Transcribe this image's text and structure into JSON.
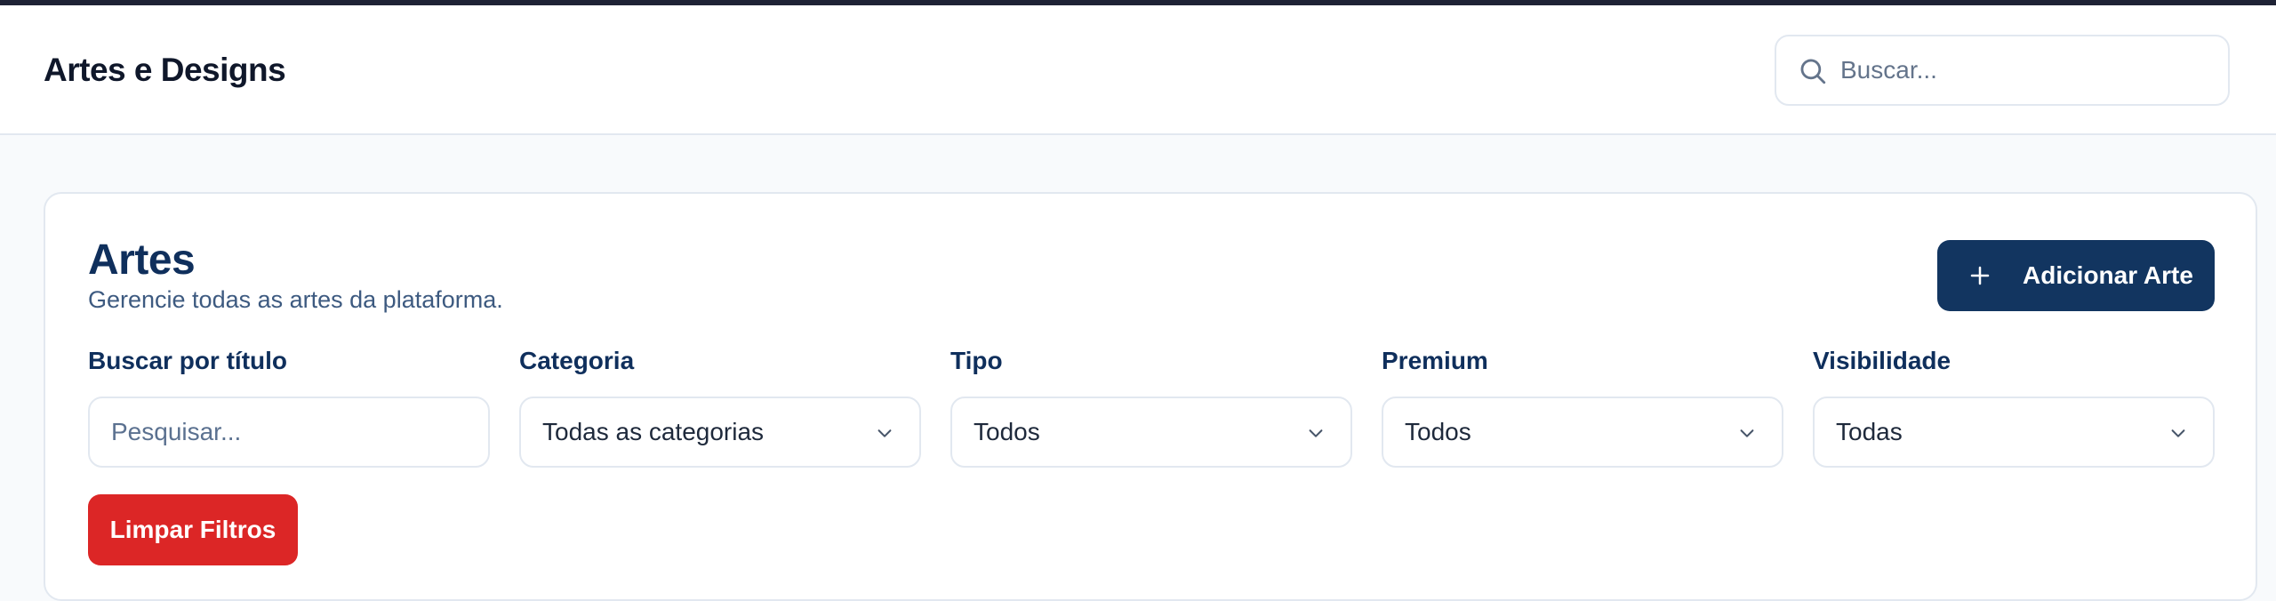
{
  "header": {
    "title": "Artes e Designs",
    "search_placeholder": "Buscar..."
  },
  "page": {
    "title": "Artes",
    "subtitle": "Gerencie todas as artes da plataforma.",
    "add_button_label": "Adicionar Arte"
  },
  "filters": {
    "title_search": {
      "label": "Buscar por título",
      "placeholder": "Pesquisar..."
    },
    "category": {
      "label": "Categoria",
      "value": "Todas as categorias"
    },
    "type": {
      "label": "Tipo",
      "value": "Todos"
    },
    "premium": {
      "label": "Premium",
      "value": "Todos"
    },
    "visibility": {
      "label": "Visibilidade",
      "value": "Todas"
    },
    "clear_button_label": "Limpar Filtros"
  },
  "colors": {
    "primary": "#123560",
    "danger": "#dc2626",
    "heading": "#0f2f5c",
    "background": "#f8fafc"
  },
  "icons": {
    "search": "search-icon",
    "add": "plus-icon",
    "dropdown": "chevron-down-icon"
  }
}
